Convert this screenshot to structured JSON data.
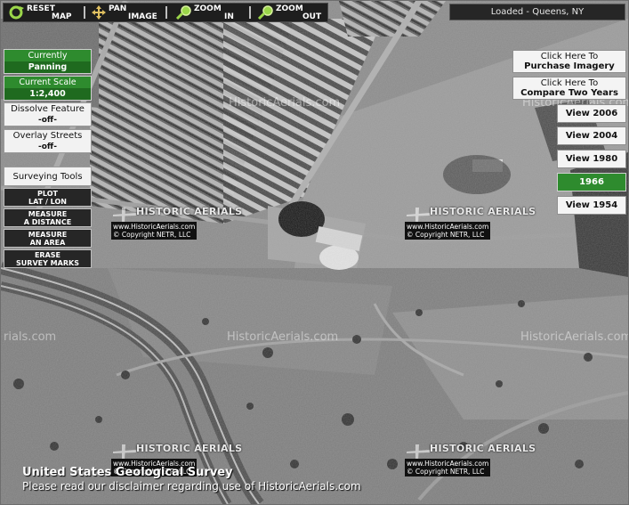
{
  "toolbar": {
    "tools": [
      {
        "line1": "RESET",
        "line2": "MAP",
        "icon": "reset-map-icon"
      },
      {
        "line1": "PAN",
        "line2": "IMAGE",
        "icon": "pan-image-icon"
      },
      {
        "line1": "ZOOM",
        "line2": "IN",
        "icon": "zoom-in-icon"
      },
      {
        "line1": "ZOOM",
        "line2": "OUT",
        "icon": "zoom-out-icon"
      }
    ]
  },
  "location": {
    "status": "Loaded - Queens, NY"
  },
  "left_panel": {
    "mode": {
      "label": "Currently",
      "value": "Panning"
    },
    "scale": {
      "label": "Current Scale",
      "value": "1:2,400"
    },
    "dissolve": {
      "label": "Dissolve Feature",
      "value": "-off-"
    },
    "overlay": {
      "label": "Overlay Streets",
      "value": "-off-"
    },
    "surveying": {
      "title": "Surveying Tools",
      "tools": [
        {
          "line1": "PLOT",
          "line2": "LAT / LON"
        },
        {
          "line1": "MEASURE",
          "line2": "A DISTANCE"
        },
        {
          "line1": "MEASURE",
          "line2": "AN AREA"
        },
        {
          "line1": "ERASE",
          "line2": "SURVEY MARKS"
        }
      ]
    }
  },
  "right_panel": {
    "purchase": {
      "line1": "Click Here To",
      "line2": "Purchase Imagery"
    },
    "compare": {
      "line1": "Click Here To",
      "line2": "Compare Two Years"
    },
    "years": [
      {
        "label": "View 2006",
        "active": false
      },
      {
        "label": "View 2004",
        "active": false
      },
      {
        "label": "View 1980",
        "active": false
      },
      {
        "label": "1966",
        "active": true
      },
      {
        "label": "View 1954",
        "active": false
      }
    ]
  },
  "watermark": {
    "brand": "HISTORIC AERIALS",
    "site": "www.HistoricAerials.com",
    "copyright": "© Copyright NETR, LLC",
    "faint": "HistoricAerials.com",
    "faint_partial": "rials.com"
  },
  "credits": {
    "source": "United States Geological Survey",
    "disclaimer": "Please read our disclaimer regarding use of HistoricAerials.com"
  },
  "colors": {
    "active_green": "#2e8b2e",
    "dark_panel": "#262626"
  }
}
